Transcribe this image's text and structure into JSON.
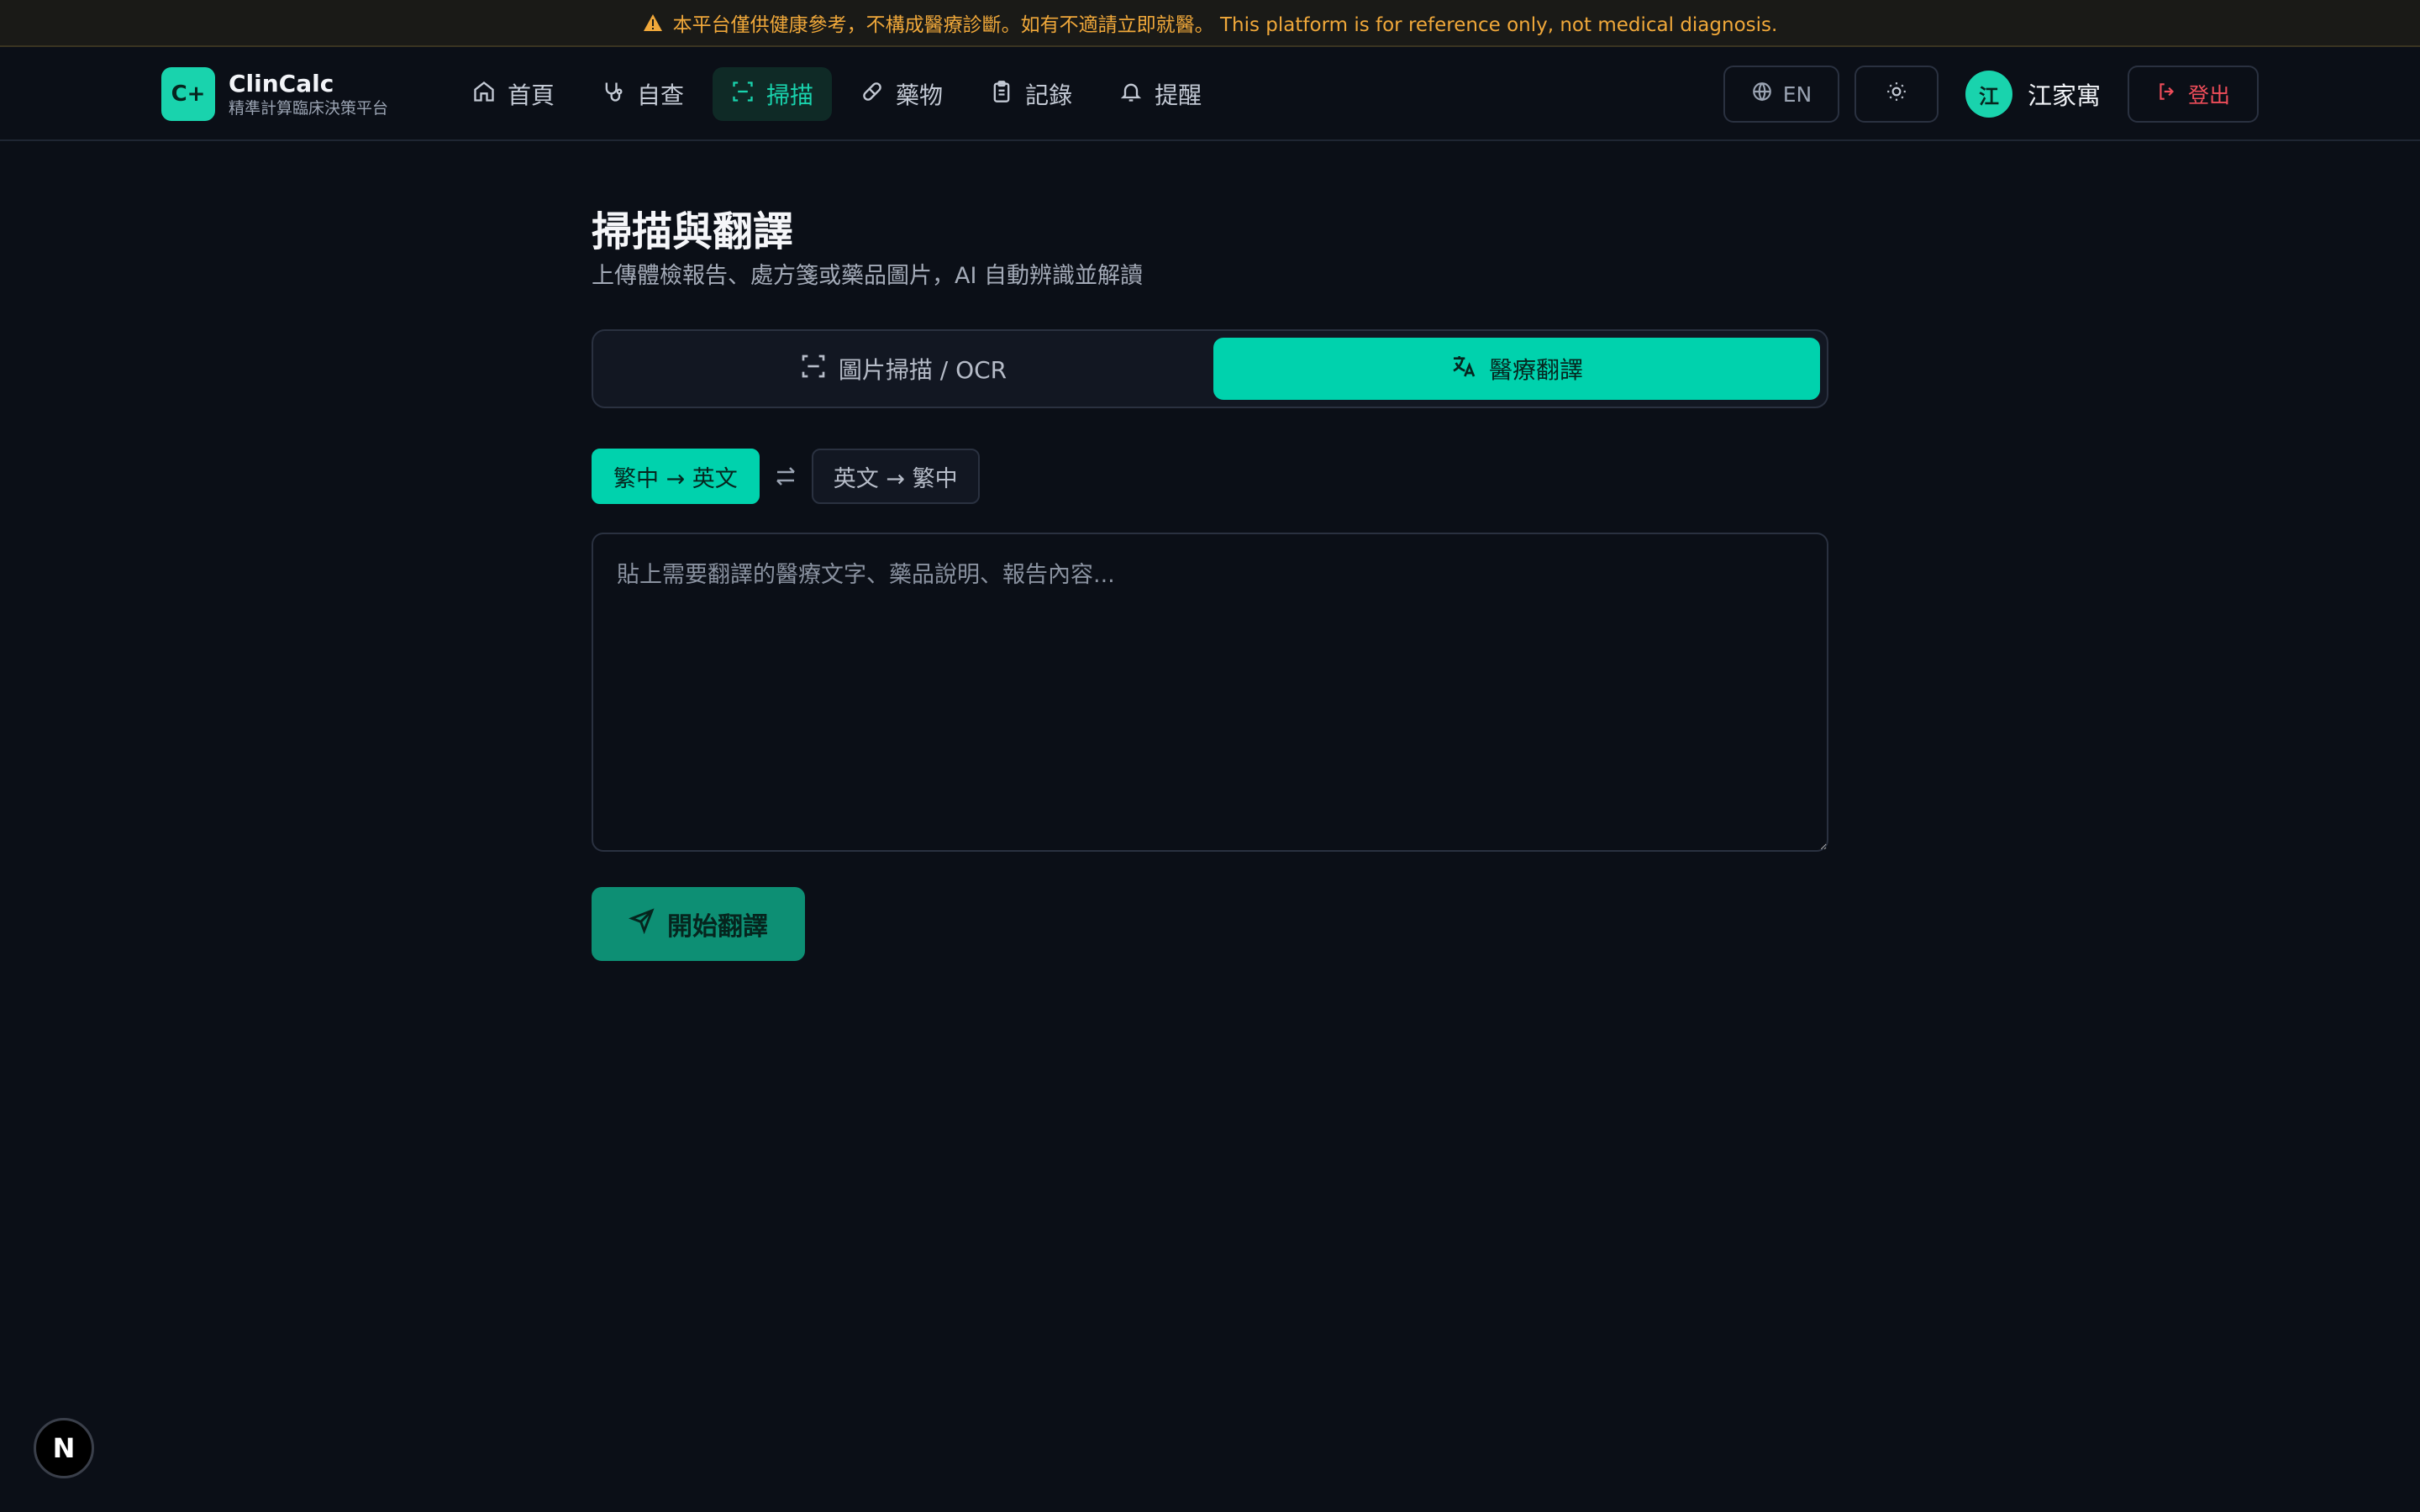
{
  "banner": {
    "text": "本平台僅供健康參考，不構成醫療診斷。如有不適請立即就醫。 This platform is for reference only, not medical diagnosis."
  },
  "brand": {
    "badge": "C+",
    "name": "ClinCalc",
    "subtitle": "精準計算臨床決策平台"
  },
  "nav": {
    "items": [
      {
        "label": "首頁",
        "icon": "home-icon"
      },
      {
        "label": "自查",
        "icon": "stethoscope-icon"
      },
      {
        "label": "掃描",
        "icon": "scan-icon",
        "active": true
      },
      {
        "label": "藥物",
        "icon": "pill-icon"
      },
      {
        "label": "記錄",
        "icon": "clipboard-icon"
      },
      {
        "label": "提醒",
        "icon": "bell-icon"
      }
    ]
  },
  "header": {
    "lang_label": "EN",
    "user_initial": "江",
    "user_name": "江家寓",
    "logout_label": "登出"
  },
  "page": {
    "title": "掃描與翻譯",
    "subtitle": "上傳體檢報告、處方箋或藥品圖片，AI 自動辨識並解讀"
  },
  "mode_tabs": [
    {
      "label": "圖片掃描 / OCR",
      "icon": "scan-icon",
      "active": false
    },
    {
      "label": "醫療翻譯",
      "icon": "translate-icon",
      "active": true
    }
  ],
  "direction": {
    "zh_to_en": "繁中 → 英文",
    "en_to_zh": "英文 → 繁中",
    "selected": "zh_to_en"
  },
  "input": {
    "placeholder": "貼上需要翻譯的醫療文字、藥品說明、報告內容...",
    "value": ""
  },
  "submit": {
    "label": "開始翻譯"
  },
  "colors": {
    "accent": "#00d2ad",
    "background": "#0b0f17",
    "warning": "#f0a83a",
    "danger": "#ef4d5a"
  }
}
